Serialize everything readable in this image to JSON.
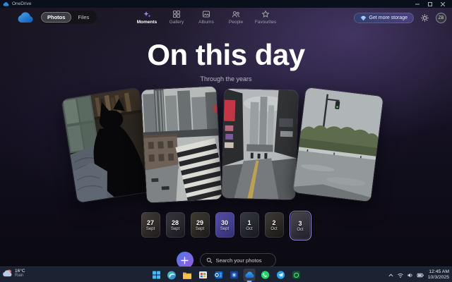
{
  "window": {
    "title": "OneDrive"
  },
  "header": {
    "toggle": {
      "photos": "Photos",
      "files": "Files"
    },
    "tabs": [
      {
        "label": "Moments"
      },
      {
        "label": "Gallery"
      },
      {
        "label": "Albums"
      },
      {
        "label": "People"
      },
      {
        "label": "Favourites"
      }
    ],
    "storage_button": "Get more storage",
    "avatar_initials": "ZB"
  },
  "main": {
    "title": "On this day",
    "subtitle": "Through the years",
    "photos": [
      {
        "alt": "Black cat sitting indoors by a window"
      },
      {
        "alt": "City buildings viewed from above"
      },
      {
        "alt": "Times Square on a rainy day"
      },
      {
        "alt": "Rainy waterfront park with trees"
      }
    ],
    "dates": [
      {
        "day": "27",
        "month": "Sept"
      },
      {
        "day": "28",
        "month": "Sept"
      },
      {
        "day": "29",
        "month": "Sept"
      },
      {
        "day": "30",
        "month": "Sept"
      },
      {
        "day": "1",
        "month": "Oct"
      },
      {
        "day": "2",
        "month": "Oct"
      },
      {
        "day": "3",
        "month": "Oct"
      }
    ],
    "search_placeholder": "Search your photos"
  },
  "taskbar": {
    "weather": {
      "temperature": "16°C",
      "condition": "Rain"
    },
    "clock": {
      "time": "12:45 AM",
      "date": "10/3/2025"
    }
  },
  "colors": {
    "accent_purple": "#8b7af0",
    "onedrive_blue": "#2a8ae0",
    "selected_chip": "#4a44a8"
  }
}
